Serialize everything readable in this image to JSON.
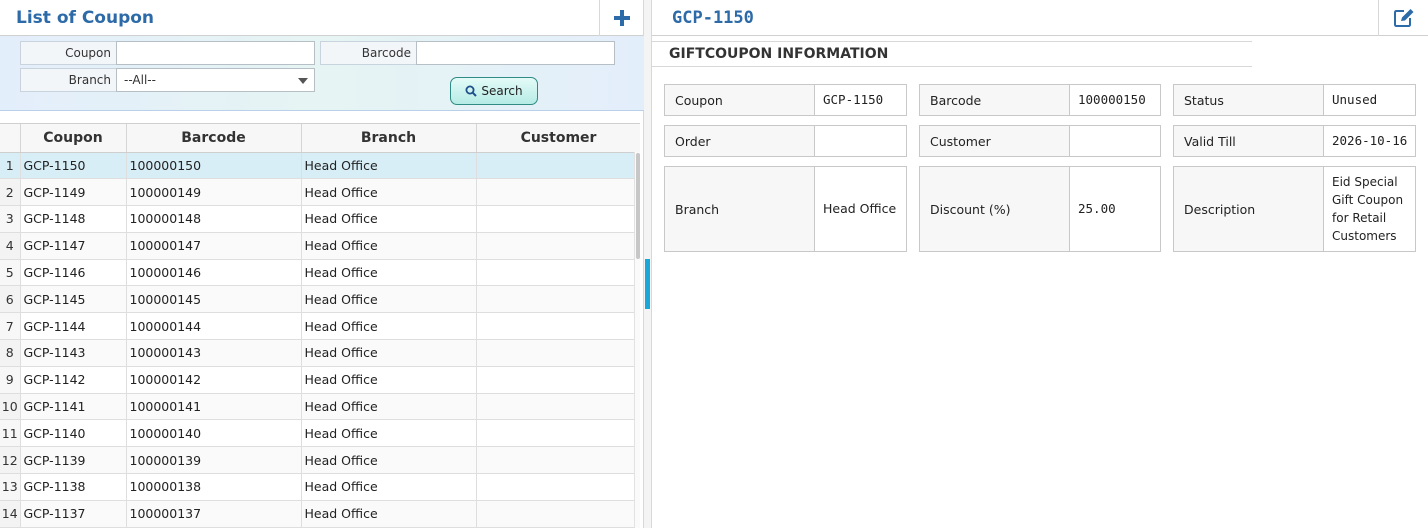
{
  "left": {
    "title": "List of Coupon",
    "add_icon": "plus-icon",
    "filter": {
      "coupon_label": "Coupon",
      "coupon_value": "",
      "barcode_label": "Barcode",
      "barcode_value": "",
      "branch_label": "Branch",
      "branch_selected": "--All--",
      "search_label": "Search",
      "search_icon": "search-icon"
    },
    "grid": {
      "columns": [
        "Coupon",
        "Barcode",
        "Branch",
        "Customer"
      ],
      "rows": [
        {
          "n": "1",
          "coupon": "GCP-1150",
          "barcode": "100000150",
          "branch": "Head Office",
          "customer": ""
        },
        {
          "n": "2",
          "coupon": "GCP-1149",
          "barcode": "100000149",
          "branch": "Head Office",
          "customer": ""
        },
        {
          "n": "3",
          "coupon": "GCP-1148",
          "barcode": "100000148",
          "branch": "Head Office",
          "customer": ""
        },
        {
          "n": "4",
          "coupon": "GCP-1147",
          "barcode": "100000147",
          "branch": "Head Office",
          "customer": ""
        },
        {
          "n": "5",
          "coupon": "GCP-1146",
          "barcode": "100000146",
          "branch": "Head Office",
          "customer": ""
        },
        {
          "n": "6",
          "coupon": "GCP-1145",
          "barcode": "100000145",
          "branch": "Head Office",
          "customer": ""
        },
        {
          "n": "7",
          "coupon": "GCP-1144",
          "barcode": "100000144",
          "branch": "Head Office",
          "customer": ""
        },
        {
          "n": "8",
          "coupon": "GCP-1143",
          "barcode": "100000143",
          "branch": "Head Office",
          "customer": ""
        },
        {
          "n": "9",
          "coupon": "GCP-1142",
          "barcode": "100000142",
          "branch": "Head Office",
          "customer": ""
        },
        {
          "n": "10",
          "coupon": "GCP-1141",
          "barcode": "100000141",
          "branch": "Head Office",
          "customer": ""
        },
        {
          "n": "11",
          "coupon": "GCP-1140",
          "barcode": "100000140",
          "branch": "Head Office",
          "customer": ""
        },
        {
          "n": "12",
          "coupon": "GCP-1139",
          "barcode": "100000139",
          "branch": "Head Office",
          "customer": ""
        },
        {
          "n": "13",
          "coupon": "GCP-1138",
          "barcode": "100000138",
          "branch": "Head Office",
          "customer": ""
        },
        {
          "n": "14",
          "coupon": "GCP-1137",
          "barcode": "100000137",
          "branch": "Head Office",
          "customer": ""
        }
      ],
      "selected_row": 0
    }
  },
  "right": {
    "title": "GCP-1150",
    "edit_icon": "edit-icon",
    "section_title": "GIFTCOUPON INFORMATION",
    "fields": {
      "coupon": {
        "label": "Coupon",
        "value": "GCP-1150"
      },
      "barcode": {
        "label": "Barcode",
        "value": "100000150"
      },
      "status": {
        "label": "Status",
        "value": "Unused"
      },
      "order": {
        "label": "Order",
        "value": ""
      },
      "customer": {
        "label": "Customer",
        "value": ""
      },
      "valid_till": {
        "label": "Valid Till",
        "value": "2026-10-16"
      },
      "branch": {
        "label": "Branch",
        "value": "Head Office"
      },
      "discount": {
        "label": "Discount (%)",
        "value": "25.00"
      },
      "description": {
        "label": "Description",
        "value": "Eid Special Gift Coupon for Retail Customers"
      }
    }
  },
  "colors": {
    "accent": "#2d6aa8",
    "selected_row": "#d8eef7",
    "splitter_handle": "#1ba8d8"
  }
}
